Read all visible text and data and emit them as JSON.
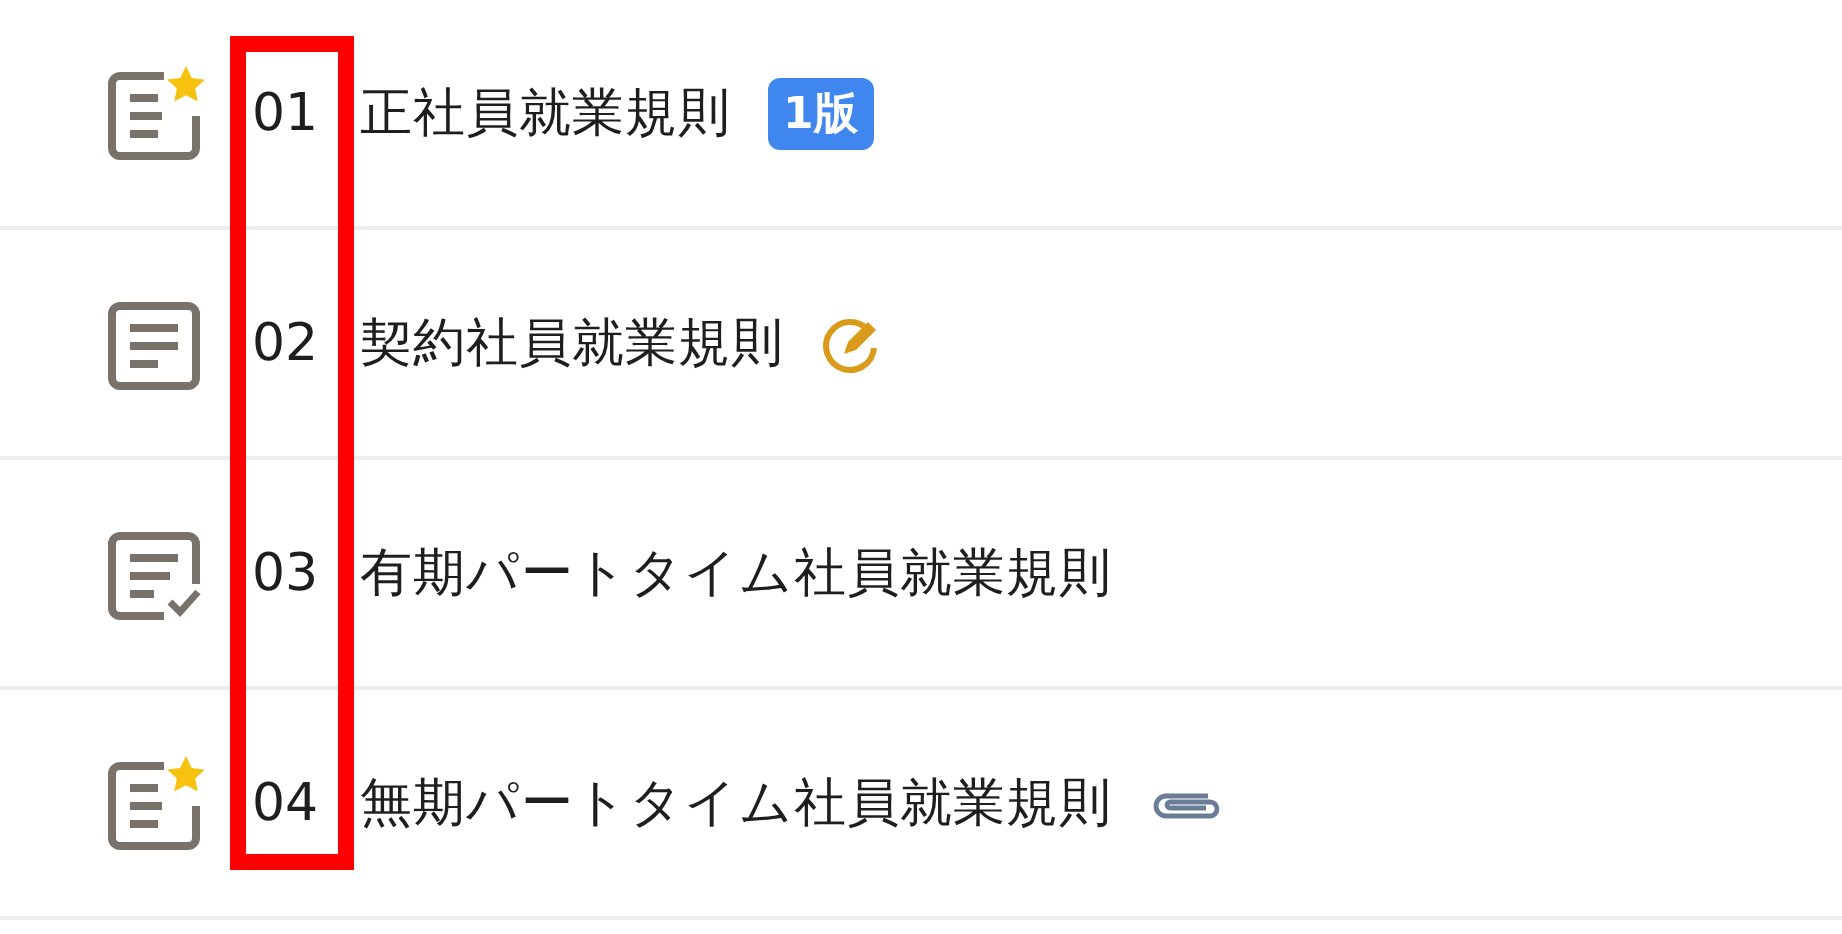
{
  "documents": [
    {
      "kind": "starred",
      "number": "01",
      "title": "正社員就業規則",
      "tag": {
        "kind": "version",
        "text": "1版"
      }
    },
    {
      "kind": "plain",
      "number": "02",
      "title": "契約社員就業規則",
      "tag": {
        "kind": "edit"
      }
    },
    {
      "kind": "checked",
      "number": "03",
      "title": "有期パートタイム社員就業規則"
    },
    {
      "kind": "starred",
      "number": "04",
      "title": "無期パートタイム社員就業規則",
      "tag": {
        "kind": "attachment"
      }
    }
  ],
  "highlight": {
    "kind": "box"
  }
}
